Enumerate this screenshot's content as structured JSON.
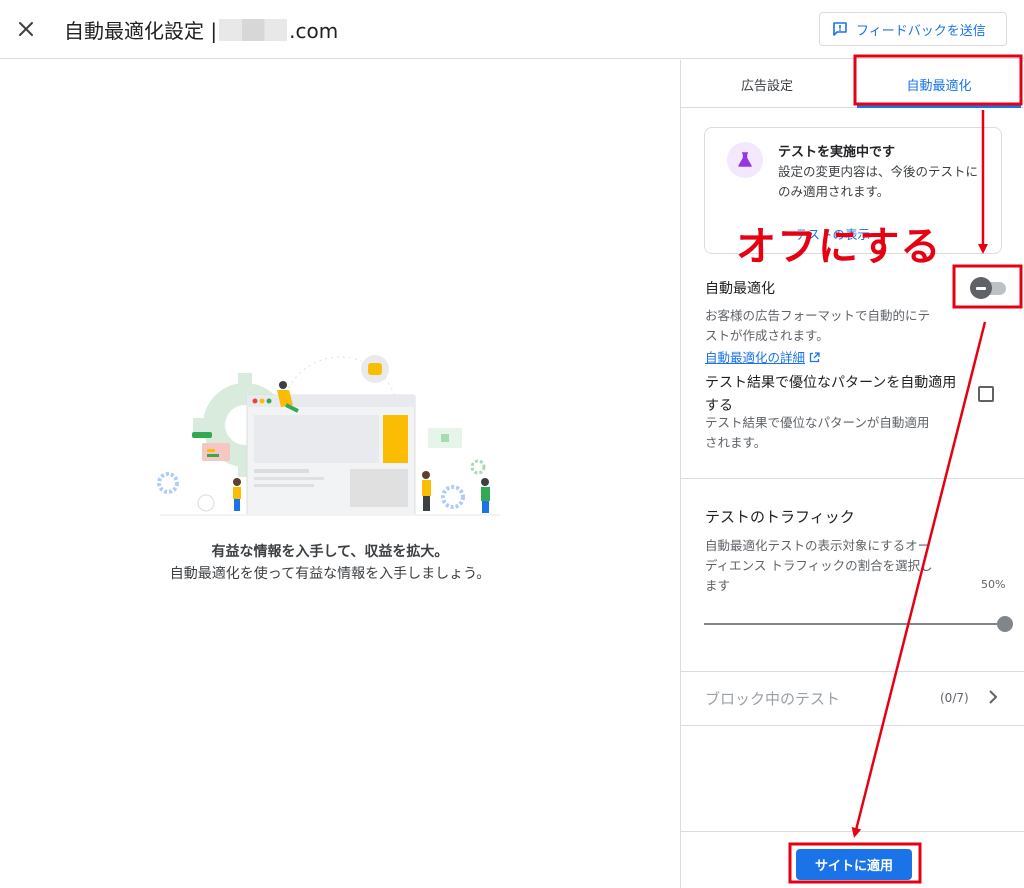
{
  "header": {
    "title_prefix": "自動最適化設定 |",
    "title_suffix": ".com",
    "feedback_label": "フィードバックを送信"
  },
  "promo": {
    "title": "有益な情報を入手して、収益を拡大。",
    "description": "自動最適化を使って有益な情報を入手しましょう。"
  },
  "tabs": [
    {
      "label": "広告設定"
    },
    {
      "label": "自動最適化"
    }
  ],
  "test_card": {
    "title": "テストを実施中です",
    "text": "設定の変更内容は、今後のテストにのみ適用されます。",
    "link": "テストの表示"
  },
  "auto_opt": {
    "label": "自動最適化",
    "toggle_state": "off",
    "description": "お客様の広告フォーマットで自動的にテストが作成されます。",
    "detail_link": "自動最適化の詳細"
  },
  "apply_pattern": {
    "label": "テスト結果で優位なパターンを自動適用する",
    "checked": false,
    "description": "テスト結果で優位なパターンが自動適用されます。"
  },
  "traffic": {
    "title": "テストのトラフィック",
    "description": "自動最適化テストの表示対象にするオーディエンス トラフィックの割合を選択します",
    "value_label": "50%",
    "value": 50
  },
  "blocked": {
    "label": "ブロック中のテスト",
    "count": "(0/7)"
  },
  "footer": {
    "submit_label": "サイトに適用"
  },
  "annotation": {
    "text": "オフにする",
    "color": "#e60012"
  },
  "colors": {
    "accent": "#1a73e8",
    "annotation": "#e60012",
    "toggle_off": "#5f6368"
  }
}
